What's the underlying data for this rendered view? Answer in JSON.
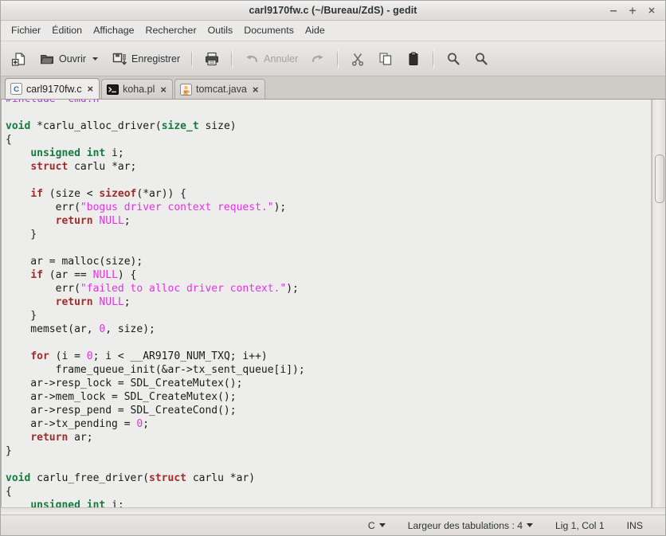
{
  "window": {
    "title": "carl9170fw.c (~/Bureau/ZdS) - gedit",
    "minimize_label": "−",
    "maximize_label": "+",
    "close_label": "×"
  },
  "menubar": {
    "items": [
      {
        "label": "Fichier"
      },
      {
        "label": "Édition"
      },
      {
        "label": "Affichage"
      },
      {
        "label": "Rechercher"
      },
      {
        "label": "Outils"
      },
      {
        "label": "Documents"
      },
      {
        "label": "Aide"
      }
    ]
  },
  "toolbar": {
    "new_label": "",
    "open_label": "Ouvrir",
    "save_label": "Enregistrer",
    "print_label": "",
    "undo_label": "Annuler",
    "redo_label": "",
    "cut_label": "",
    "copy_label": "",
    "paste_label": "",
    "find_label": "",
    "replace_label": ""
  },
  "tabs": [
    {
      "label": "carl9170fw.c",
      "icon": "c-source-icon",
      "active": true,
      "close": "×"
    },
    {
      "label": "koha.pl",
      "icon": "perl-script-icon",
      "active": false,
      "close": "×"
    },
    {
      "label": "tomcat.java",
      "icon": "java-source-icon",
      "active": false,
      "close": "×"
    }
  ],
  "editor": {
    "language": "C",
    "lines": [
      {
        "tokens": [
          {
            "t": "#include \"cmd.h\"",
            "c": "pp"
          }
        ]
      },
      {
        "tokens": []
      },
      {
        "tokens": [
          {
            "t": "void",
            "c": "t"
          },
          {
            "t": " *carlu_alloc_driver(",
            "c": ""
          },
          {
            "t": "size_t",
            "c": "t"
          },
          {
            "t": " size)",
            "c": ""
          }
        ]
      },
      {
        "tokens": [
          {
            "t": "{",
            "c": ""
          }
        ]
      },
      {
        "tokens": [
          {
            "t": "    ",
            "c": ""
          },
          {
            "t": "unsigned int",
            "c": "t"
          },
          {
            "t": " i;",
            "c": ""
          }
        ]
      },
      {
        "tokens": [
          {
            "t": "    ",
            "c": ""
          },
          {
            "t": "struct",
            "c": "k"
          },
          {
            "t": " carlu *ar;",
            "c": ""
          }
        ]
      },
      {
        "tokens": []
      },
      {
        "tokens": [
          {
            "t": "    ",
            "c": ""
          },
          {
            "t": "if",
            "c": "k"
          },
          {
            "t": " (size < ",
            "c": ""
          },
          {
            "t": "sizeof",
            "c": "k"
          },
          {
            "t": "(*ar)) {",
            "c": ""
          }
        ]
      },
      {
        "tokens": [
          {
            "t": "        err(",
            "c": ""
          },
          {
            "t": "\"bogus driver context request.\"",
            "c": "s"
          },
          {
            "t": ");",
            "c": ""
          }
        ]
      },
      {
        "tokens": [
          {
            "t": "        ",
            "c": ""
          },
          {
            "t": "return",
            "c": "k"
          },
          {
            "t": " ",
            "c": ""
          },
          {
            "t": "NULL",
            "c": "n"
          },
          {
            "t": ";",
            "c": ""
          }
        ]
      },
      {
        "tokens": [
          {
            "t": "    }",
            "c": ""
          }
        ]
      },
      {
        "tokens": []
      },
      {
        "tokens": [
          {
            "t": "    ar = malloc(size);",
            "c": ""
          }
        ]
      },
      {
        "tokens": [
          {
            "t": "    ",
            "c": ""
          },
          {
            "t": "if",
            "c": "k"
          },
          {
            "t": " (ar == ",
            "c": ""
          },
          {
            "t": "NULL",
            "c": "n"
          },
          {
            "t": ") {",
            "c": ""
          }
        ]
      },
      {
        "tokens": [
          {
            "t": "        err(",
            "c": ""
          },
          {
            "t": "\"failed to alloc driver context.\"",
            "c": "s"
          },
          {
            "t": ");",
            "c": ""
          }
        ]
      },
      {
        "tokens": [
          {
            "t": "        ",
            "c": ""
          },
          {
            "t": "return",
            "c": "k"
          },
          {
            "t": " ",
            "c": ""
          },
          {
            "t": "NULL",
            "c": "n"
          },
          {
            "t": ";",
            "c": ""
          }
        ]
      },
      {
        "tokens": [
          {
            "t": "    }",
            "c": ""
          }
        ]
      },
      {
        "tokens": [
          {
            "t": "    memset(ar, ",
            "c": ""
          },
          {
            "t": "0",
            "c": "n"
          },
          {
            "t": ", size);",
            "c": ""
          }
        ]
      },
      {
        "tokens": []
      },
      {
        "tokens": [
          {
            "t": "    ",
            "c": ""
          },
          {
            "t": "for",
            "c": "k"
          },
          {
            "t": " (i = ",
            "c": ""
          },
          {
            "t": "0",
            "c": "n"
          },
          {
            "t": "; i < __AR9170_NUM_TXQ; i++)",
            "c": ""
          }
        ]
      },
      {
        "tokens": [
          {
            "t": "        frame_queue_init(&ar->tx_sent_queue[i]);",
            "c": ""
          }
        ]
      },
      {
        "tokens": [
          {
            "t": "    ar->resp_lock = SDL_CreateMutex();",
            "c": ""
          }
        ]
      },
      {
        "tokens": [
          {
            "t": "    ar->mem_lock = SDL_CreateMutex();",
            "c": ""
          }
        ]
      },
      {
        "tokens": [
          {
            "t": "    ar->resp_pend = SDL_CreateCond();",
            "c": ""
          }
        ]
      },
      {
        "tokens": [
          {
            "t": "    ar->tx_pending = ",
            "c": ""
          },
          {
            "t": "0",
            "c": "n"
          },
          {
            "t": ";",
            "c": ""
          }
        ]
      },
      {
        "tokens": [
          {
            "t": "    ",
            "c": ""
          },
          {
            "t": "return",
            "c": "k"
          },
          {
            "t": " ar;",
            "c": ""
          }
        ]
      },
      {
        "tokens": [
          {
            "t": "}",
            "c": ""
          }
        ]
      },
      {
        "tokens": []
      },
      {
        "tokens": [
          {
            "t": "void",
            "c": "t"
          },
          {
            "t": " carlu_free_driver(",
            "c": ""
          },
          {
            "t": "struct",
            "c": "k"
          },
          {
            "t": " carlu *ar)",
            "c": ""
          }
        ]
      },
      {
        "tokens": [
          {
            "t": "{",
            "c": ""
          }
        ]
      },
      {
        "tokens": [
          {
            "t": "    ",
            "c": ""
          },
          {
            "t": "unsigned int",
            "c": "t"
          },
          {
            "t": " i;",
            "c": ""
          }
        ]
      }
    ]
  },
  "statusbar": {
    "language": "C",
    "tab_width": "Largeur des tabulations : 4",
    "position": "Lig 1, Col 1",
    "insert_mode": "INS"
  },
  "colors": {
    "keyword": "#a02c2c",
    "type": "#157a3e",
    "string": "#e334e3",
    "number": "#e334e3",
    "preprocessor": "#a347d1",
    "editor_background": "#ededeb",
    "chrome_background": "#e2e0dd"
  }
}
